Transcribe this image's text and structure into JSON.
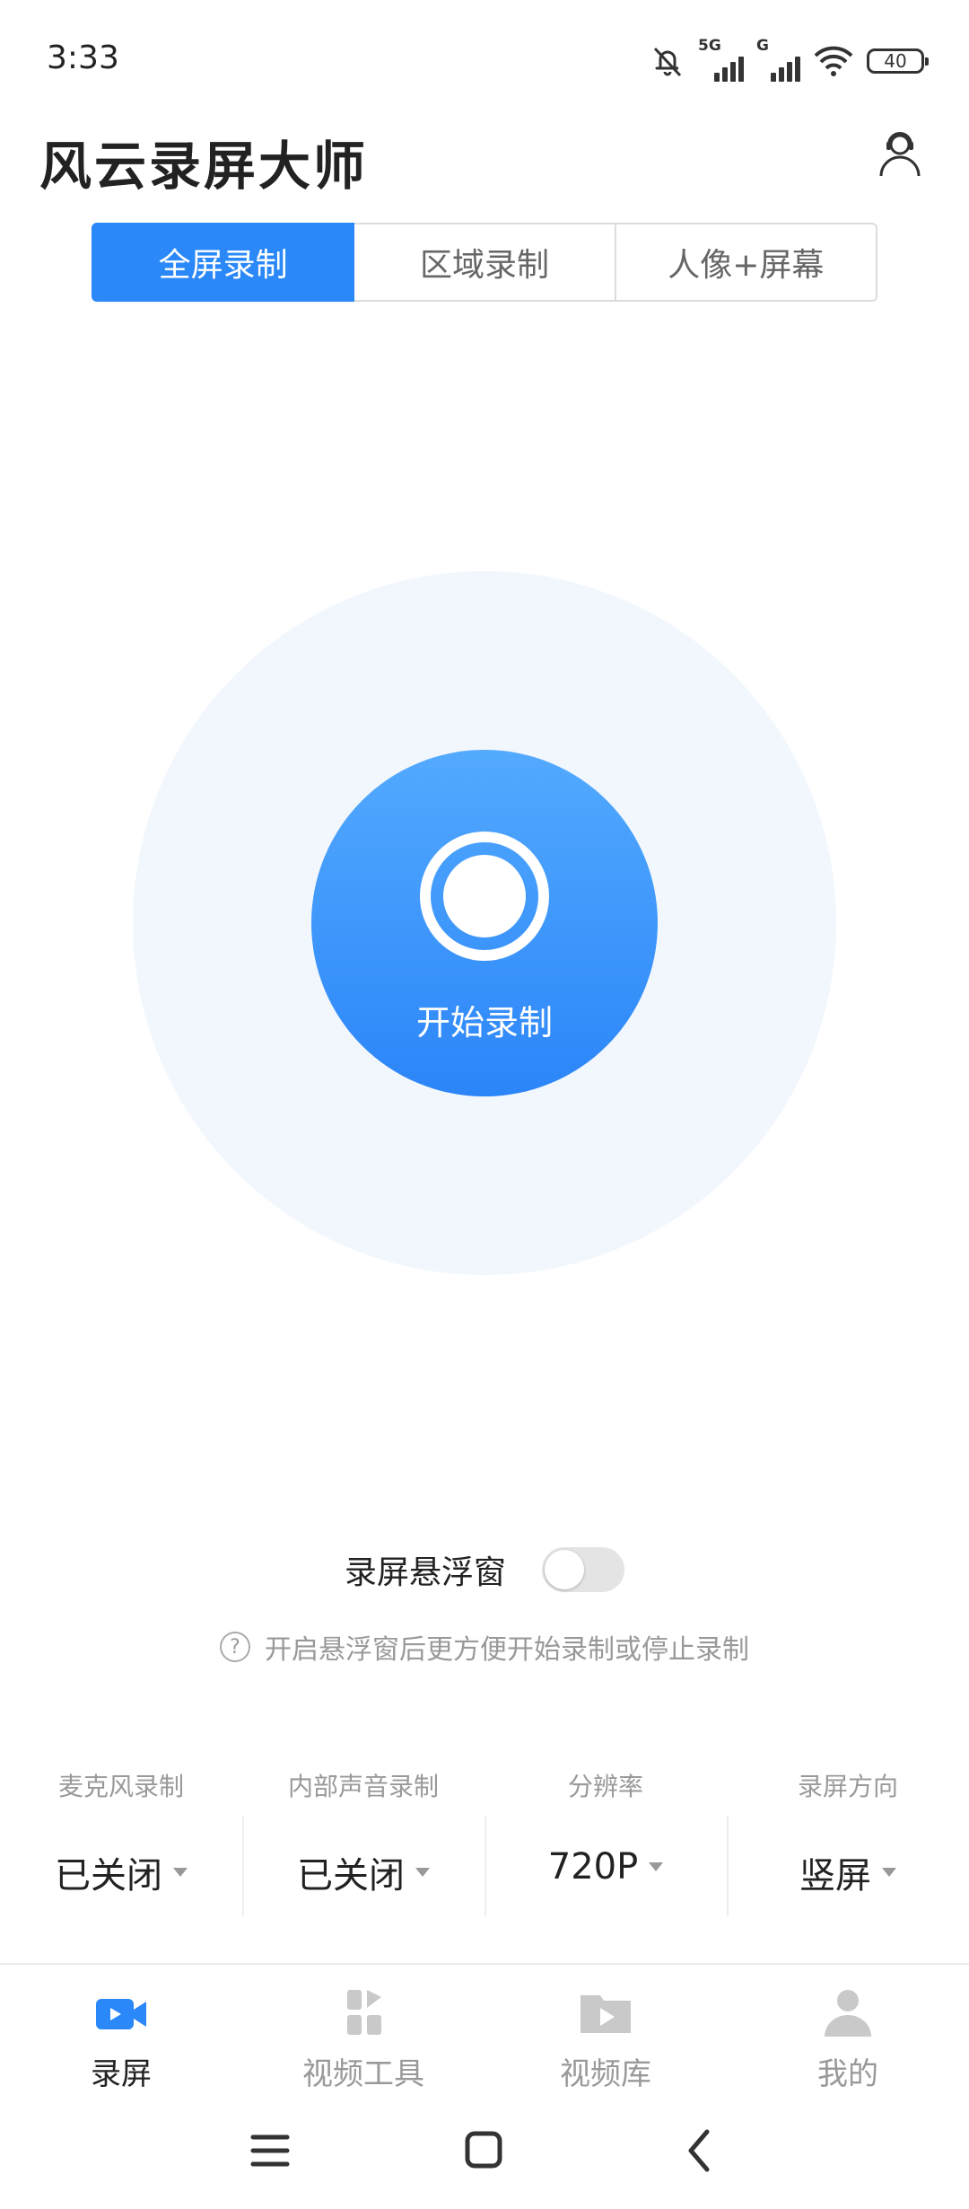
{
  "status_bar": {
    "time": "3:33",
    "signal1_tag": "5G",
    "signal2_tag": "G",
    "battery": "40"
  },
  "header": {
    "title": "风云录屏大师"
  },
  "mode_tabs": [
    {
      "label": "全屏录制",
      "active": true
    },
    {
      "label": "区域录制",
      "active": false
    },
    {
      "label": "人像+屏幕",
      "active": false
    }
  ],
  "record": {
    "label": "开始录制",
    "accent": "#2a88f8"
  },
  "floating_window": {
    "label": "录屏悬浮窗",
    "enabled": false,
    "help_icon_glyph": "?",
    "hint": "开启悬浮窗后更方便开始录制或停止录制"
  },
  "settings": [
    {
      "label": "麦克风录制",
      "value": "已关闭"
    },
    {
      "label": "内部声音录制",
      "value": "已关闭"
    },
    {
      "label": "分辨率",
      "value": "720P"
    },
    {
      "label": "录屏方向",
      "value": "竖屏"
    }
  ],
  "bottom_nav": [
    {
      "label": "录屏",
      "icon": "video-camera-icon",
      "active": true
    },
    {
      "label": "视频工具",
      "icon": "grid-icon",
      "active": false
    },
    {
      "label": "视频库",
      "icon": "video-folder-icon",
      "active": false
    },
    {
      "label": "我的",
      "icon": "user-icon",
      "active": false
    }
  ],
  "colors": {
    "accent": "#2a88f8",
    "inactive_icon": "#c9c9c9"
  }
}
